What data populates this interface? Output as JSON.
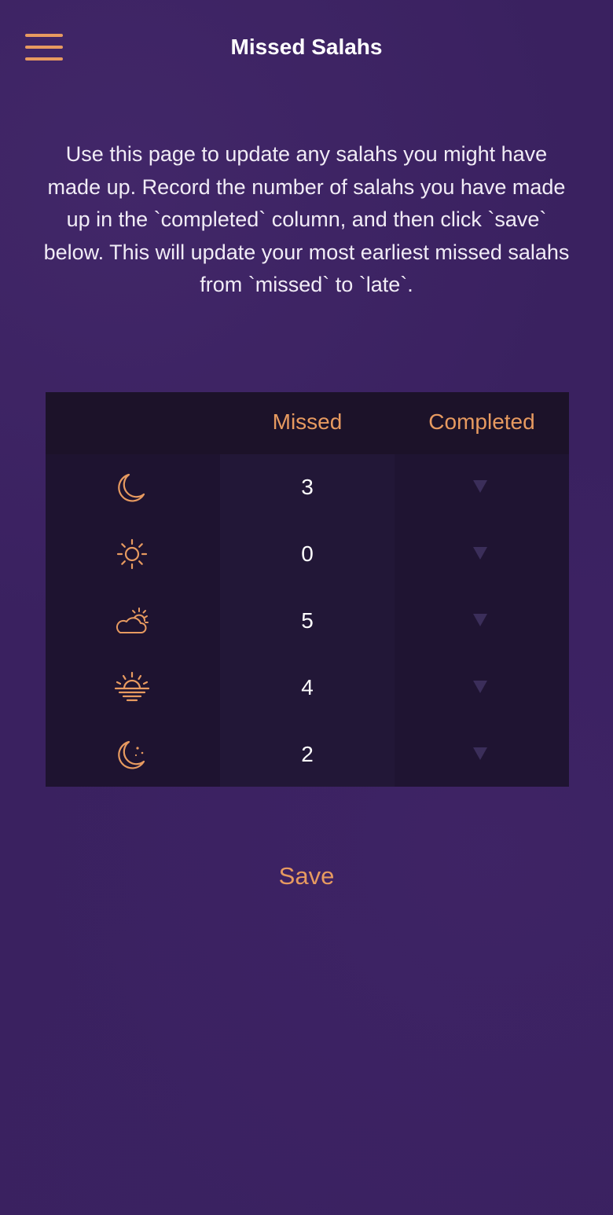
{
  "header": {
    "title": "Missed Salahs",
    "menu_icon": "hamburger-menu-icon"
  },
  "intro": {
    "text": "Use this page to update any salahs you might have made up. Record the number of salahs you have made up in the `completed` column, and then click `save` below. This will update your most earliest missed salahs from `missed` to `late`."
  },
  "table": {
    "columns": {
      "icon": "",
      "missed": "Missed",
      "completed": "Completed"
    },
    "rows": [
      {
        "icon": "crescent-moon-icon",
        "missed": "3",
        "completed": ""
      },
      {
        "icon": "sun-icon",
        "missed": "0",
        "completed": ""
      },
      {
        "icon": "sun-behind-cloud-icon",
        "missed": "5",
        "completed": ""
      },
      {
        "icon": "sunset-icon",
        "missed": "4",
        "completed": ""
      },
      {
        "icon": "moon-and-stars-icon",
        "missed": "2",
        "completed": ""
      }
    ]
  },
  "actions": {
    "save_label": "Save"
  },
  "colors": {
    "accent": "#e79a60",
    "background": "#3a2160",
    "table_background": "#201531"
  }
}
